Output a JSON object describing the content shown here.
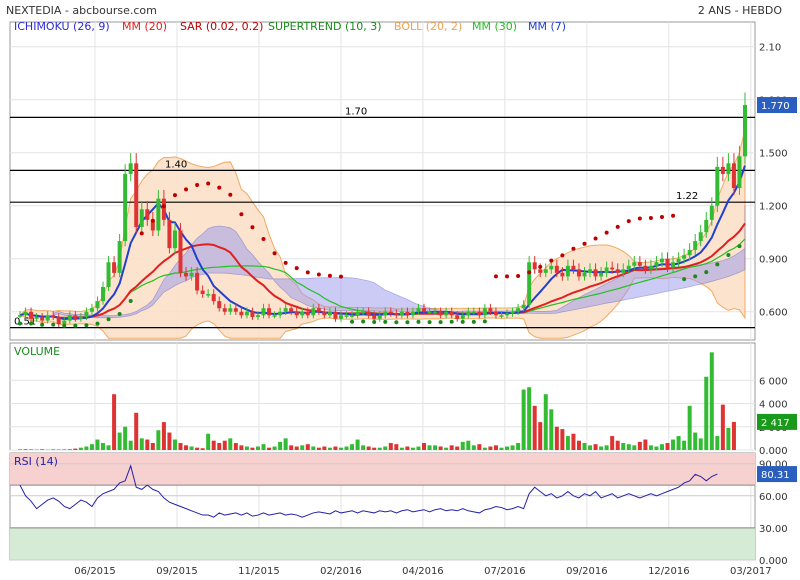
{
  "header": {
    "title": "NEXTEDIA - abcbourse.com",
    "period": "2 ANS - HEBDO"
  },
  "indicators": [
    {
      "label": "ICHIMOKU (26, 9)",
      "color": "#2b2bd6"
    },
    {
      "label": "MM (20)",
      "color": "#e02020"
    },
    {
      "label": "SAR (0.02, 0.2)",
      "color": "#c00000"
    },
    {
      "label": "SUPERTREND (10, 3)",
      "color": "#1a8a1a"
    },
    {
      "label": "BOLL (20, 2)",
      "color": "#f0a050"
    },
    {
      "label": "MM (30)",
      "color": "#22c022"
    },
    {
      "label": "MM (7)",
      "color": "#2040d0"
    }
  ],
  "colors": {
    "up": "#33bb33",
    "down": "#dd3333",
    "cloud": "#9999ee",
    "boll_fill": "#fbe1c8",
    "rsi_over": "#f7d0d0",
    "rsi_under": "#d6ebd6",
    "rsi_line": "#2222aa",
    "price_tag": "#2a5fbf"
  },
  "annotations": [
    {
      "text": "1.70",
      "price": 1.7
    },
    {
      "text": "1.40",
      "price": 1.4
    },
    {
      "text": "1.22",
      "price": 1.22
    },
    {
      "text": "0.51",
      "price": 0.51
    }
  ],
  "chart_data": [
    {
      "type": "candlestick",
      "title": "",
      "x_ticks": [
        "06/2015",
        "09/2015",
        "11/2015",
        "02/2016",
        "04/2016",
        "07/2016",
        "09/2016",
        "12/2016",
        "03/2017"
      ],
      "y_ticks": [
        "2.10",
        "1.800",
        "1.500",
        "1.200",
        "0.900",
        "0.600"
      ],
      "ylim": [
        0.44,
        2.24
      ],
      "last_price": "1.770",
      "close": [
        0.58,
        0.6,
        0.56,
        0.57,
        0.55,
        0.58,
        0.57,
        0.53,
        0.55,
        0.58,
        0.56,
        0.57,
        0.6,
        0.62,
        0.66,
        0.74,
        0.88,
        0.82,
        1.0,
        1.38,
        1.44,
        1.08,
        1.18,
        1.12,
        1.06,
        1.24,
        1.12,
        0.96,
        1.06,
        0.82,
        0.8,
        0.82,
        0.72,
        0.7,
        0.7,
        0.66,
        0.62,
        0.6,
        0.62,
        0.6,
        0.58,
        0.6,
        0.57,
        0.58,
        0.62,
        0.58,
        0.58,
        0.6,
        0.62,
        0.6,
        0.58,
        0.6,
        0.58,
        0.62,
        0.6,
        0.58,
        0.6,
        0.56,
        0.58,
        0.58,
        0.58,
        0.6,
        0.6,
        0.58,
        0.56,
        0.58,
        0.6,
        0.59,
        0.58,
        0.6,
        0.58,
        0.6,
        0.62,
        0.6,
        0.6,
        0.6,
        0.58,
        0.6,
        0.58,
        0.56,
        0.58,
        0.6,
        0.6,
        0.58,
        0.62,
        0.6,
        0.58,
        0.58,
        0.59,
        0.6,
        0.62,
        0.64,
        0.88,
        0.84,
        0.82,
        0.84,
        0.86,
        0.82,
        0.8,
        0.86,
        0.84,
        0.8,
        0.82,
        0.84,
        0.8,
        0.82,
        0.85,
        0.84,
        0.82,
        0.84,
        0.86,
        0.88,
        0.86,
        0.84,
        0.86,
        0.88,
        0.9,
        0.85,
        0.88,
        0.9,
        0.92,
        0.95,
        1.0,
        1.05,
        1.12,
        1.2,
        1.42,
        1.38,
        1.44,
        1.3,
        1.48,
        1.77
      ],
      "volume": {
        "y_ticks": [
          "6 000",
          "4 000",
          "2 000",
          "0.000"
        ],
        "last_value": "2 417",
        "max": 8000
      },
      "volume_values": [
        60,
        80,
        50,
        40,
        60,
        30,
        50,
        40,
        60,
        80,
        120,
        200,
        300,
        500,
        900,
        600,
        400,
        4800,
        1500,
        2000,
        800,
        3200,
        1000,
        900,
        600,
        1700,
        2400,
        1500,
        900,
        600,
        400,
        300,
        200,
        150,
        1400,
        800,
        600,
        800,
        1000,
        600,
        400,
        300,
        200,
        300,
        500,
        200,
        300,
        700,
        1000,
        400,
        300,
        400,
        500,
        300,
        200,
        300,
        200,
        300,
        200,
        300,
        500,
        900,
        400,
        300,
        200,
        200,
        300,
        600,
        500,
        200,
        300,
        200,
        300,
        600,
        400,
        400,
        300,
        200,
        400,
        300,
        700,
        800,
        400,
        500,
        200,
        300,
        400,
        200,
        300,
        400,
        600,
        5200,
        5400,
        3800,
        2400,
        4800,
        3500,
        2000,
        1800,
        1200,
        1400,
        800,
        600,
        400,
        500,
        300,
        400,
        1200,
        800,
        600,
        500,
        400,
        700,
        900,
        400,
        300,
        500,
        600,
        900,
        1200,
        800,
        3800,
        1500,
        1000,
        6300,
        14000,
        1200,
        3900,
        1900,
        2417
      ],
      "rsi": {
        "label": "RSI (14)",
        "last_value": "80.31",
        "ylim": [
          0,
          100
        ],
        "y_ticks": [
          "90.00",
          "60.00",
          "30.00",
          "0.000"
        ]
      },
      "rsi_values": [
        70,
        60,
        55,
        48,
        52,
        56,
        58,
        55,
        50,
        48,
        52,
        56,
        54,
        50,
        58,
        62,
        64,
        66,
        72,
        74,
        88,
        68,
        66,
        70,
        66,
        64,
        58,
        54,
        52,
        50,
        48,
        46,
        44,
        42,
        42,
        40,
        44,
        42,
        43,
        44,
        42,
        44,
        41,
        42,
        44,
        42,
        43,
        44,
        42,
        43,
        42,
        40,
        42,
        44,
        45,
        44,
        43,
        46,
        44,
        45,
        46,
        44,
        46,
        45,
        44,
        46,
        45,
        46,
        44,
        46,
        47,
        45,
        46,
        47,
        45,
        47,
        48,
        46,
        47,
        46,
        48,
        46,
        45,
        44,
        47,
        48,
        50,
        49,
        47,
        48,
        50,
        48,
        62,
        68,
        64,
        60,
        62,
        58,
        60,
        64,
        60,
        58,
        62,
        60,
        64,
        58,
        60,
        62,
        58,
        60,
        62,
        60,
        58,
        60,
        62,
        60,
        62,
        64,
        66,
        68,
        72,
        74,
        80,
        78,
        74,
        78,
        80.31
      ]
    }
  ]
}
